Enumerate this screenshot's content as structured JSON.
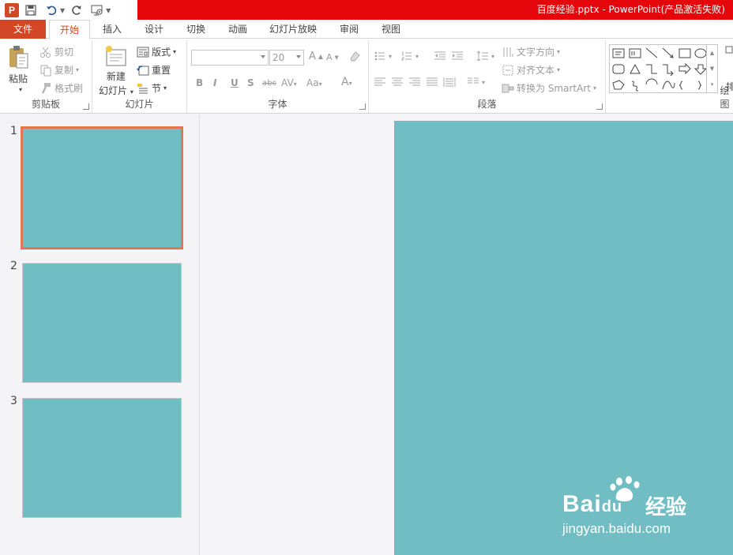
{
  "window": {
    "title": "百度经验.pptx -   PowerPoint(产品激活失败)"
  },
  "qat": {
    "logo": "P"
  },
  "tabs": [
    {
      "label": "文件",
      "active": false
    },
    {
      "label": "开始",
      "active": true
    },
    {
      "label": "插入",
      "active": false
    },
    {
      "label": "设计",
      "active": false
    },
    {
      "label": "切换",
      "active": false
    },
    {
      "label": "动画",
      "active": false
    },
    {
      "label": "幻灯片放映",
      "active": false
    },
    {
      "label": "审阅",
      "active": false
    },
    {
      "label": "视图",
      "active": false
    }
  ],
  "clipboard": {
    "label": "剪贴板",
    "paste": "粘贴",
    "cut": "剪切",
    "copy": "复制",
    "format_painter": "格式刷"
  },
  "slides_group": {
    "label": "幻灯片",
    "new_slide_line1": "新建",
    "new_slide_line2": "幻灯片",
    "layout": "版式",
    "reset": "重置",
    "section": "节"
  },
  "font": {
    "label": "字体",
    "font_name": "",
    "font_size": "20",
    "bold": "B",
    "italic": "I",
    "underline": "U",
    "shadow": "S",
    "strike": "abc",
    "spacing": "AV",
    "case": "Aa",
    "color": "A",
    "grow": "A",
    "shrink": "A"
  },
  "paragraph": {
    "label": "段落",
    "text_direction": "文字方向",
    "align_text": "对齐文本",
    "convert_smartart": "转换为 SmartArt"
  },
  "drawing": {
    "label": "绘图",
    "arrange": "排"
  },
  "thumbnails": [
    {
      "number": "1",
      "selected": true
    },
    {
      "number": "2",
      "selected": false
    },
    {
      "number": "3",
      "selected": false
    }
  ],
  "colors": {
    "accent": "#d24726",
    "title_bar": "#e4060b",
    "slide_bg": "#70bdc3",
    "selection": "#e07751"
  },
  "watermark": {
    "brand": "Bai",
    "brand_paw": "du",
    "brand_cn": "经验",
    "url": "jingyan.baidu.com"
  }
}
